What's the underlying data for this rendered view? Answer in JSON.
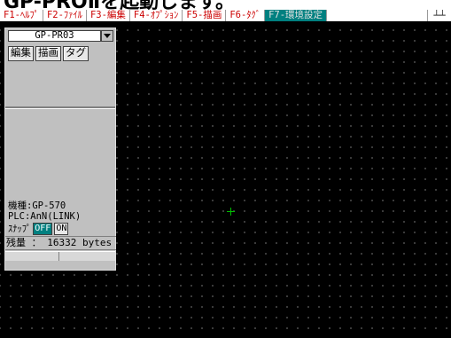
{
  "heading": "GP-PROⅡを起動します。",
  "fkeys": [
    {
      "label": "F1-ﾍﾙﾌﾟ"
    },
    {
      "label": "F2-ﾌｧｲﾙ"
    },
    {
      "label": "F3-編集"
    },
    {
      "label": "F4-ｵﾌﾟｼｮﾝ"
    },
    {
      "label": "F5-描画"
    },
    {
      "label": "F6-ﾀｸﾞ"
    },
    {
      "label": "F7-環境設定"
    }
  ],
  "fkey_extra": "┴┴",
  "panel": {
    "title": "GP-PR03",
    "buttons": [
      {
        "label": "編集"
      },
      {
        "label": "描画"
      },
      {
        "label": "タグ"
      }
    ],
    "model": "機種:GP-570",
    "plc": "PLC:AnN(LINK)",
    "snap_label": "ｽﾅｯﾌﾟ",
    "snap_off": "OFF",
    "snap_on": "ON",
    "memory": "残量 ： 16332 bytes"
  },
  "colors": {
    "fkey_text": "#cc0000",
    "active_fkey": "#008080",
    "canvas": "#000000",
    "cursor": "#00c000"
  }
}
